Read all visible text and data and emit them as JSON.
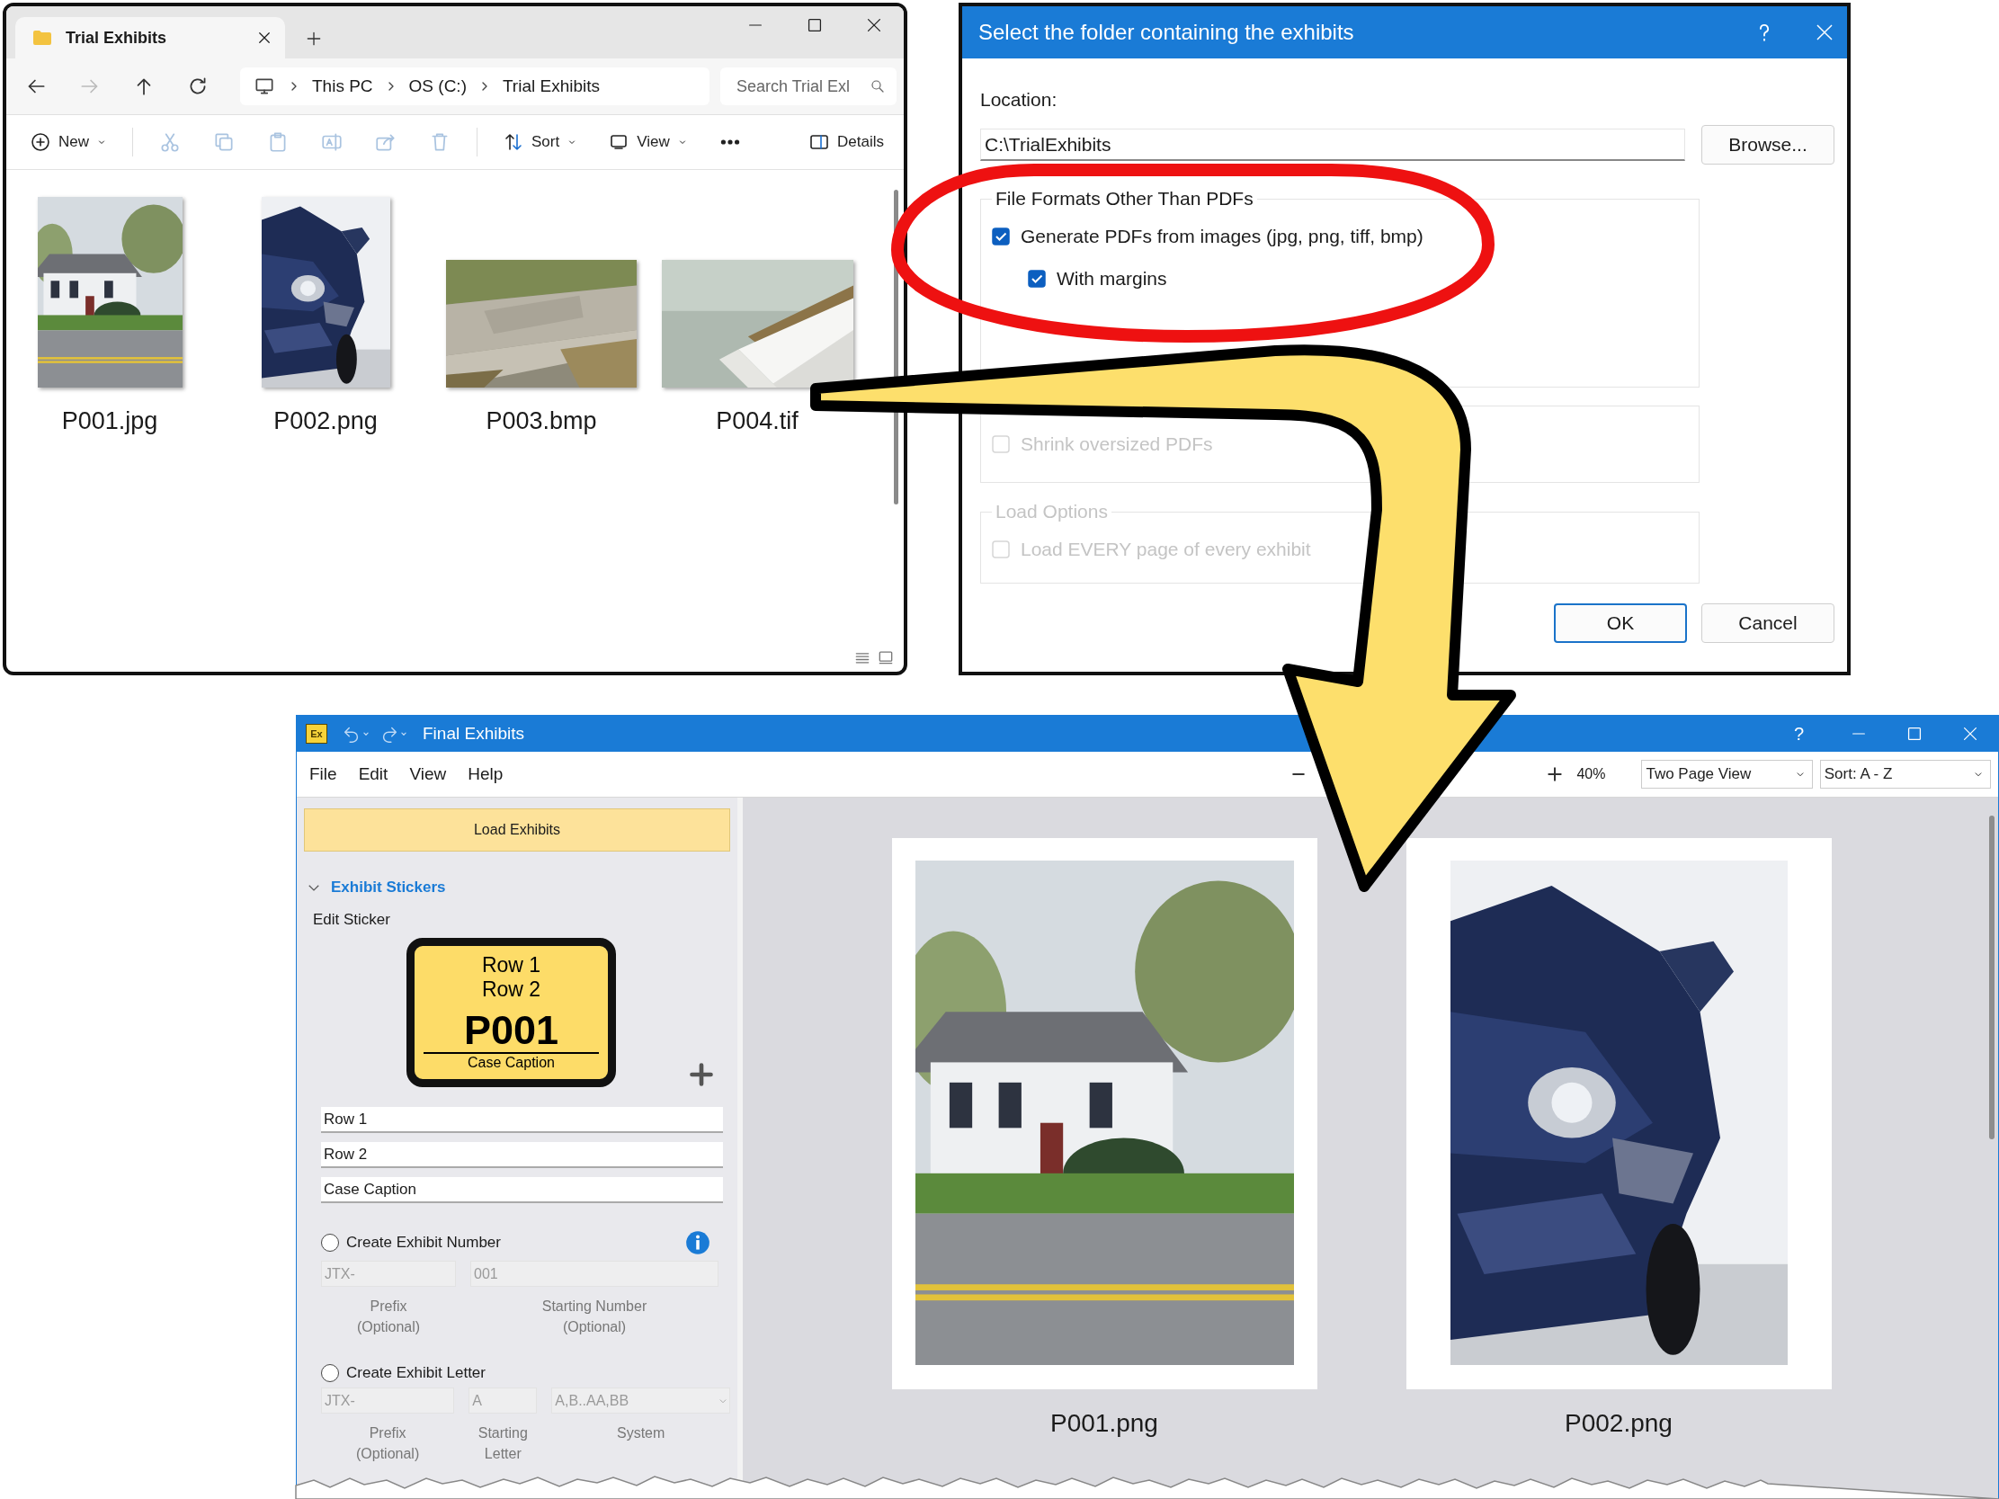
{
  "explorer": {
    "tab": {
      "title": "Trial Exhibits"
    },
    "nav": [
      {
        "kind": "back",
        "disabled": false
      },
      {
        "kind": "forward",
        "disabled": true
      },
      {
        "kind": "up",
        "disabled": false
      },
      {
        "kind": "refresh",
        "disabled": false
      }
    ],
    "address": [
      "This PC",
      "OS (C:)",
      "Trial Exhibits"
    ],
    "search": {
      "placeholder": "Search Trial Exl"
    },
    "toolbar": [
      {
        "kind": "new",
        "label": "New",
        "disabled": false
      },
      {
        "kind": "cut",
        "disabled": true
      },
      {
        "kind": "copy",
        "disabled": true
      },
      {
        "kind": "paste",
        "disabled": true
      },
      {
        "kind": "rename",
        "disabled": true
      },
      {
        "kind": "share",
        "disabled": true
      },
      {
        "kind": "delete",
        "disabled": true
      },
      {
        "kind": "sort",
        "label": "Sort",
        "disabled": false
      },
      {
        "kind": "view",
        "label": "View",
        "disabled": false
      },
      {
        "kind": "more",
        "disabled": false
      },
      {
        "kind": "details",
        "label": "Details",
        "disabled": false
      }
    ],
    "files": [
      {
        "name": "P001.jpg"
      },
      {
        "name": "P002.png"
      },
      {
        "name": "P003.bmp"
      },
      {
        "name": "P004.tif"
      }
    ]
  },
  "dialog": {
    "title": "Select the folder containing the exhibits",
    "location_label": "Location:",
    "location": "C:\\TrialExhibits",
    "browse_button": "Browse...",
    "groups": [
      {
        "label": "File Formats Other Than PDFs",
        "disabled": false,
        "options": [
          {
            "label": "Generate PDFs from images (jpg, png, tiff, bmp)",
            "checked": true,
            "disabled": false,
            "children": [
              {
                "label": "With margins",
                "checked": true,
                "disabled": false
              }
            ]
          }
        ]
      },
      {
        "options": [
          {
            "label": "Shrink oversized PDFs",
            "checked": false,
            "disabled": true
          }
        ]
      },
      {
        "label": "Load Options",
        "disabled": true,
        "options": [
          {
            "label": "Load EVERY page of every exhibit",
            "checked": false,
            "disabled": true
          }
        ]
      }
    ],
    "buttons": [
      {
        "label": "OK",
        "default": true
      },
      {
        "label": "Cancel",
        "default": false
      }
    ]
  },
  "app": {
    "icon": "Ex",
    "title": "Final Exhibits",
    "menu": [
      "File",
      "Edit",
      "View",
      "Help"
    ],
    "help": "?",
    "zoom": {
      "reading": "40%"
    },
    "dropdowns": [
      {
        "value": "Two Page View"
      },
      {
        "value": "Sort: A - Z"
      }
    ],
    "load_button": "Load Exhibits",
    "section": {
      "title": "Exhibit Stickers",
      "expanded": true
    },
    "edit_sticker_label": "Edit Sticker",
    "sticker": {
      "row_1": "Row 1",
      "row_2": "Row 2",
      "number": "P001",
      "caption": "Case Caption"
    },
    "sticker_fields": [
      "Row 1",
      "Row 2",
      "Case Caption"
    ],
    "numbering": [
      {
        "label": "Create Exhibit Number",
        "selected": false,
        "fields": [
          {
            "kind": "text",
            "value": "JTX-",
            "disabled": true,
            "caption": [
              "Prefix",
              "(Optional)"
            ]
          },
          {
            "kind": "text",
            "value": "001",
            "disabled": true,
            "caption": [
              "Starting Number",
              "(Optional)"
            ]
          }
        ]
      },
      {
        "label": "Create Exhibit Letter",
        "selected": false,
        "fields": [
          {
            "kind": "text",
            "value": "JTX-",
            "disabled": true,
            "caption": [
              "Prefix",
              "(Optional)"
            ]
          },
          {
            "kind": "text",
            "value": "A",
            "disabled": true,
            "caption": [
              "Starting",
              "Letter"
            ]
          },
          {
            "kind": "dropdown",
            "value": "A,B..AA,BB",
            "disabled": true,
            "caption": [
              "System"
            ]
          }
        ]
      }
    ],
    "pages": [
      {
        "caption": "P001.png"
      },
      {
        "caption": "P002.png"
      }
    ]
  }
}
